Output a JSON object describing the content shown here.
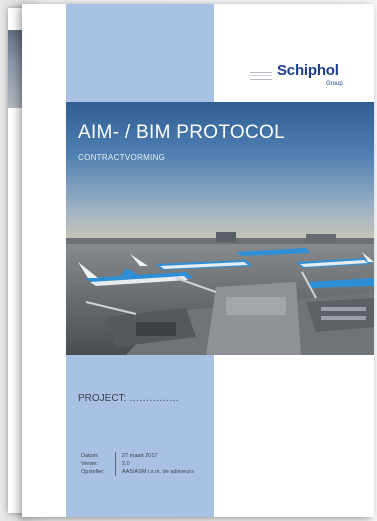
{
  "document": {
    "title": "AIM- / BIM PROTOCOL",
    "subtitle": "CONTRACTVORMING",
    "project_line": "PROJECT: ……………"
  },
  "logo": {
    "name": "Schiphol",
    "tagline": "Group"
  },
  "meta": [
    {
      "label": "Datum:",
      "value": "27 maart 2017"
    },
    {
      "label": "Versie:",
      "value": "2.0"
    },
    {
      "label": "Opsteller:",
      "value": "AAS/ASM i.s.m. de adviseurs"
    }
  ],
  "colors": {
    "band": "#a9c2e4",
    "brand": "#1d3f8e",
    "aircraft_livery": "#2e8fd6"
  },
  "photo": {
    "subject": "airport-apron-with-aircraft"
  }
}
